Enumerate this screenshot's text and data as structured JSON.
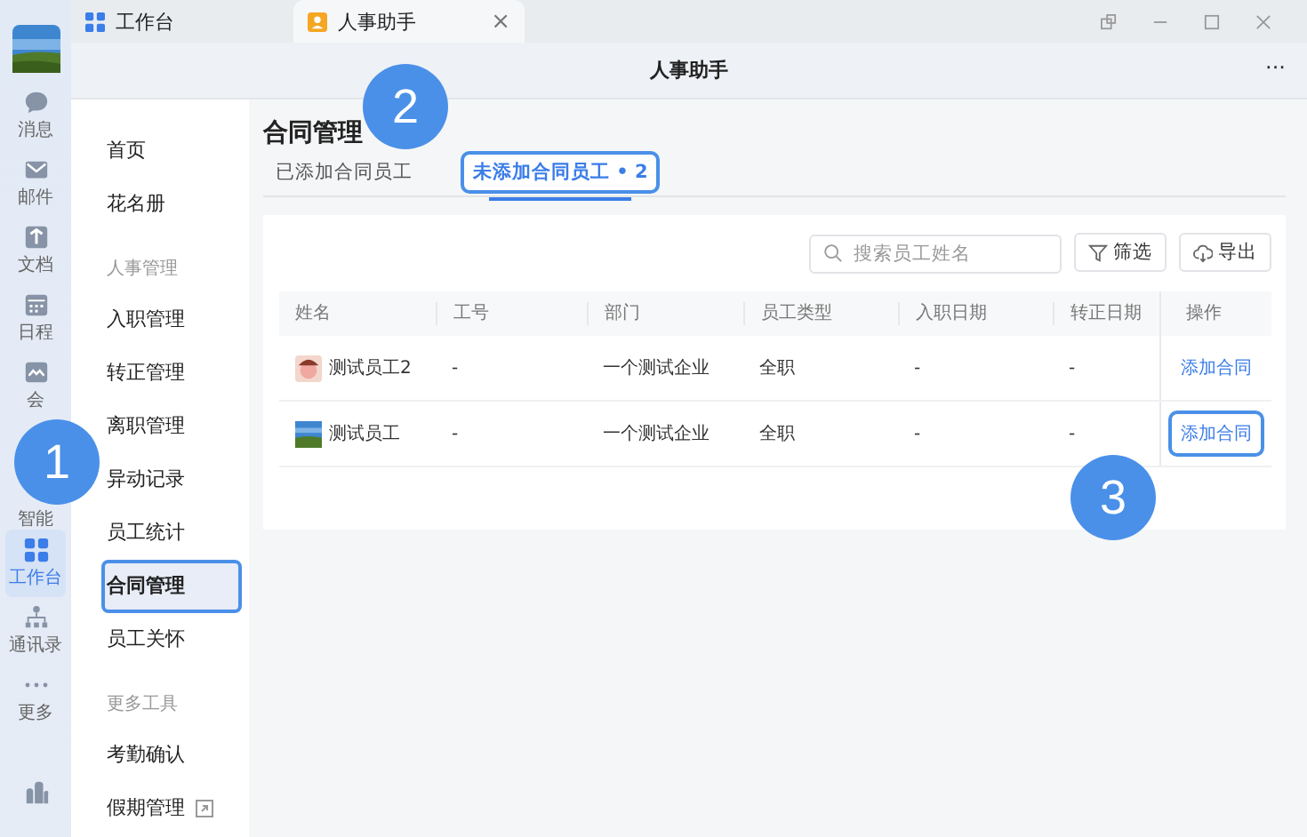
{
  "tabs": [
    {
      "label": "工作台",
      "kind": "grid",
      "selected": false
    },
    {
      "label": "人事助手",
      "kind": "person",
      "selected": true,
      "close": "×"
    }
  ],
  "title": "人事助手",
  "more": "···",
  "rail": [
    {
      "label": "消息",
      "kind": "chat",
      "selected": false
    },
    {
      "label": "邮件",
      "kind": "mail",
      "selected": false
    },
    {
      "label": "文档",
      "kind": "doc",
      "selected": false
    },
    {
      "label": "日程",
      "kind": "calendar",
      "selected": false
    },
    {
      "label": "会",
      "kind": "meeting",
      "selected": false
    },
    {
      "label": "智能",
      "kind": "none",
      "selected": false
    },
    {
      "label": "工作台",
      "kind": "grid",
      "selected": true
    },
    {
      "label": "通讯录",
      "kind": "org",
      "selected": false
    },
    {
      "label": "更多",
      "kind": "dots",
      "selected": false
    }
  ],
  "nav": [
    {
      "kind": "item",
      "label": "首页",
      "selected": false,
      "highlighted": false
    },
    {
      "kind": "item",
      "label": "花名册",
      "selected": false,
      "highlighted": false
    },
    {
      "kind": "section",
      "label": "人事管理"
    },
    {
      "kind": "item",
      "label": "入职管理",
      "selected": false,
      "highlighted": false
    },
    {
      "kind": "item",
      "label": "转正管理",
      "selected": false,
      "highlighted": false
    },
    {
      "kind": "item",
      "label": "离职管理",
      "selected": false,
      "highlighted": false
    },
    {
      "kind": "item",
      "label": "异动记录",
      "selected": false,
      "highlighted": false
    },
    {
      "kind": "item",
      "label": "员工统计",
      "selected": false,
      "highlighted": false
    },
    {
      "kind": "item",
      "label": "合同管理",
      "selected": true,
      "highlighted": true
    },
    {
      "kind": "item",
      "label": "员工关怀",
      "selected": false,
      "highlighted": false
    },
    {
      "kind": "section",
      "label": "更多工具"
    },
    {
      "kind": "item",
      "label": "考勤确认",
      "selected": false,
      "highlighted": false
    },
    {
      "kind": "item",
      "label": "假期管理",
      "selected": false,
      "highlighted": false,
      "external": true
    }
  ],
  "heading": "合同管理",
  "subtabs": [
    {
      "label": "已添加合同员工",
      "selected": false,
      "highlighted": false
    },
    {
      "label": "未添加合同员工 • 2",
      "selected": true,
      "highlighted": true
    }
  ],
  "search": {
    "placeholder": "搜索员工姓名"
  },
  "buttons": [
    {
      "label": "筛选",
      "kind": "filter"
    },
    {
      "label": "导出",
      "kind": "export"
    }
  ],
  "table": {
    "columns": [
      "姓名",
      "工号",
      "部门",
      "员工类型",
      "入职日期",
      "转正日期",
      "操作"
    ],
    "rows": [
      {
        "kind": "illustration",
        "cells": [
          "测试员工2",
          "-",
          "一个测试企业",
          "全职",
          "-",
          "-"
        ],
        "action": "添加合同",
        "highlighted": false
      },
      {
        "kind": "picture",
        "cells": [
          "测试员工",
          "-",
          "一个测试企业",
          "全职",
          "-",
          "-"
        ],
        "action": "添加合同",
        "highlighted": true
      }
    ]
  },
  "annotations": [
    {
      "number": "1"
    },
    {
      "number": "2"
    },
    {
      "number": "3"
    }
  ]
}
